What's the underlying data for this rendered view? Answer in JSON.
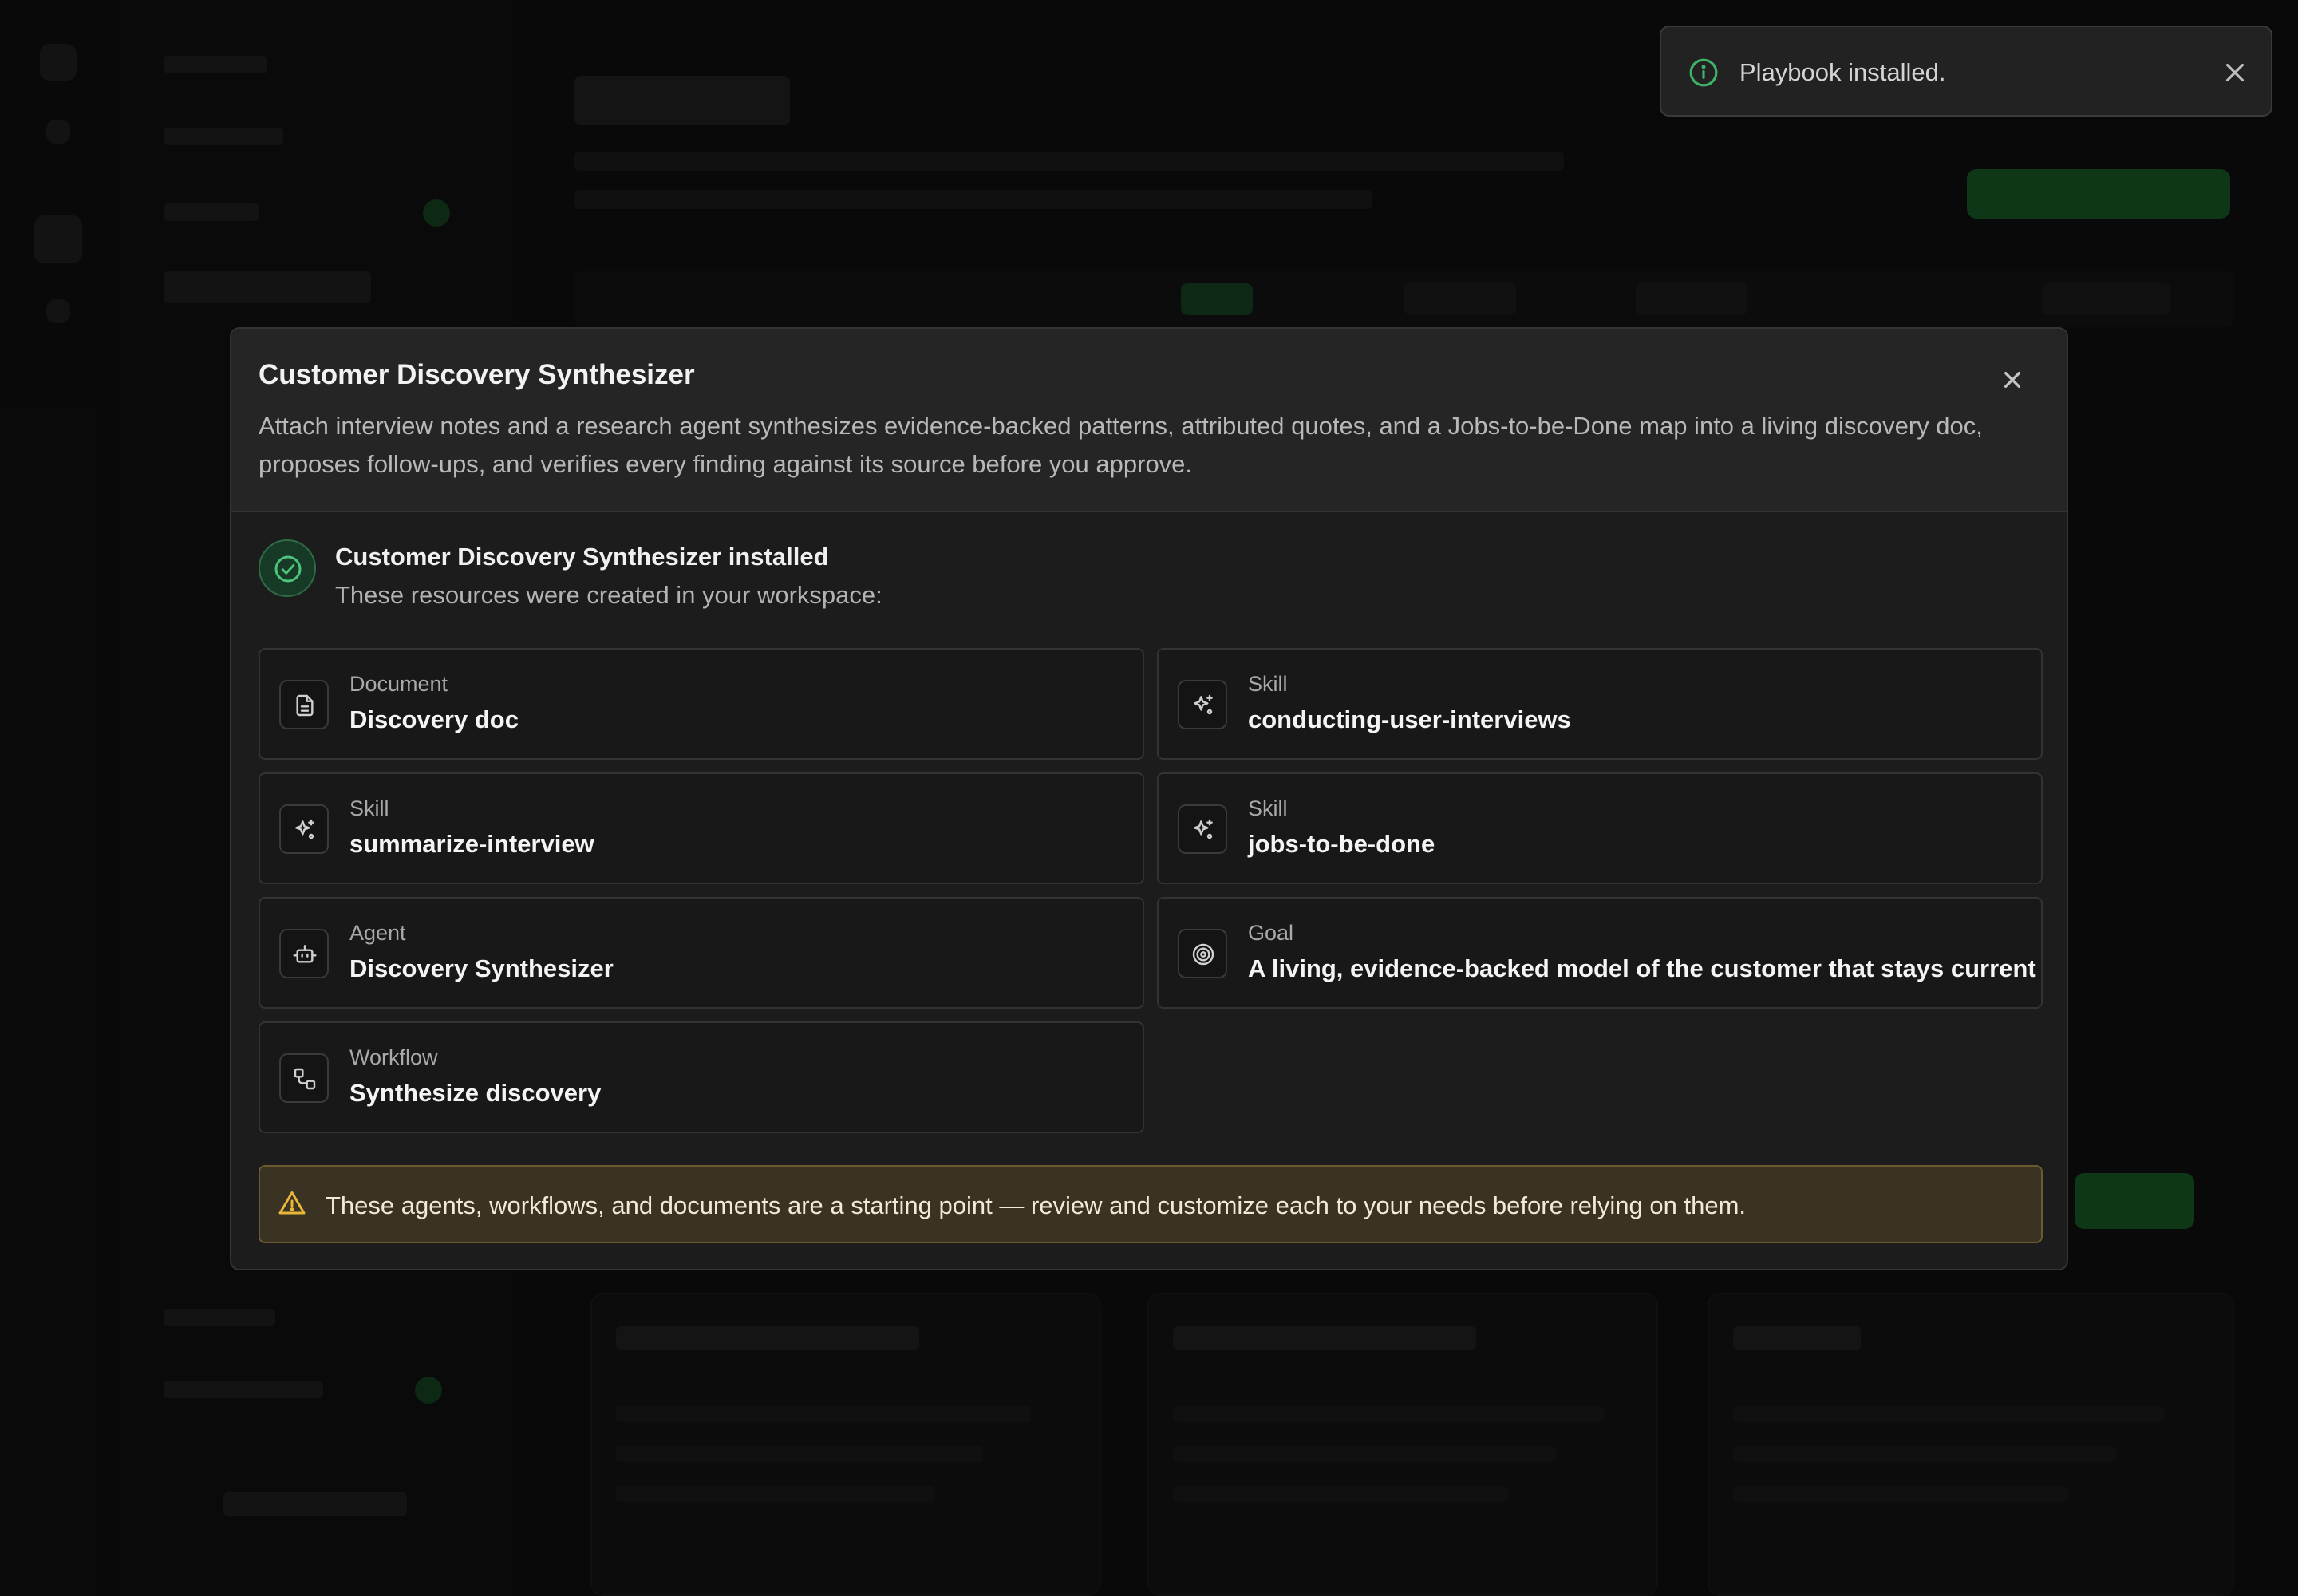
{
  "toast": {
    "message": "Playbook installed.",
    "icon": "info-icon",
    "close_icon": "close-icon",
    "accent_color": "#3fb26a"
  },
  "modal": {
    "title": "Customer Discovery Synthesizer",
    "description": "Attach interview notes and a research agent synthesizes evidence-backed patterns, attributed quotes, and a Jobs-to-be-Done map into a living discovery doc, proposes follow-ups, and verifies every finding against its source before you approve.",
    "close_icon": "close-icon",
    "status": {
      "title": "Customer Discovery Synthesizer installed",
      "subtitle": "These resources were created in your workspace:",
      "icon": "check-circle-icon",
      "color": "#3fb26a"
    },
    "resources": [
      {
        "type": "Document",
        "name": "Discovery doc",
        "icon": "document-icon"
      },
      {
        "type": "Skill",
        "name": "conducting-user-interviews",
        "icon": "sparkles-icon"
      },
      {
        "type": "Skill",
        "name": "summarize-interview",
        "icon": "sparkles-icon"
      },
      {
        "type": "Skill",
        "name": "jobs-to-be-done",
        "icon": "sparkles-icon"
      },
      {
        "type": "Agent",
        "name": "Discovery Synthesizer",
        "icon": "robot-icon"
      },
      {
        "type": "Goal",
        "name": "A living, evidence-backed model of the customer that stays current",
        "icon": "target-icon"
      },
      {
        "type": "Workflow",
        "name": "Synthesize discovery",
        "icon": "workflow-icon"
      }
    ],
    "warning": {
      "text": "These agents, workflows, and documents are a starting point — review and customize each to your needs before relying on them.",
      "icon": "warning-triangle-icon",
      "color": "#e8b73a"
    }
  }
}
